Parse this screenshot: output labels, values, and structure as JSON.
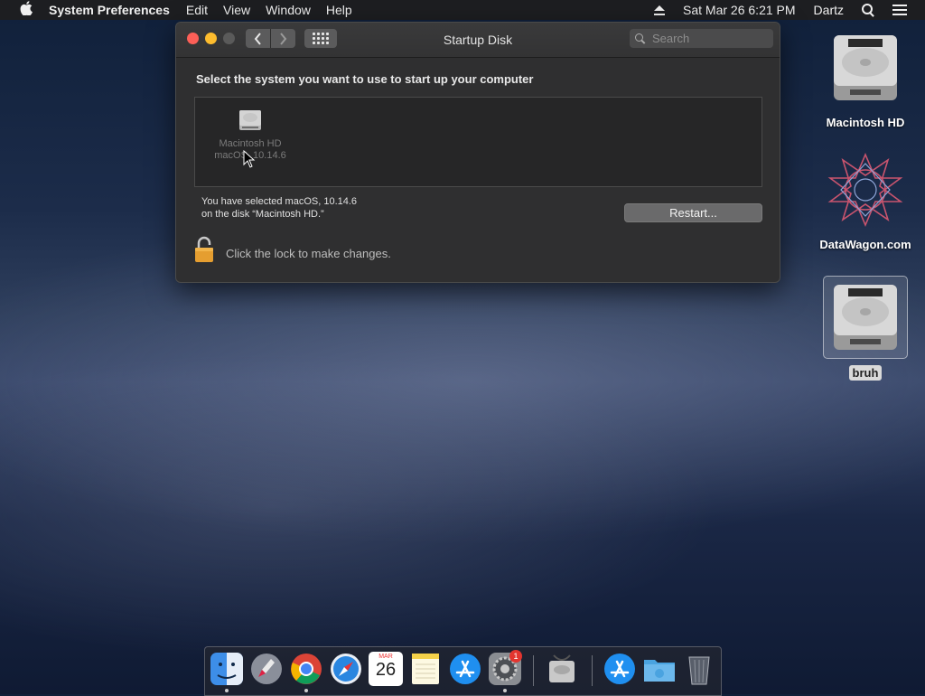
{
  "menubar": {
    "app_name": "System Preferences",
    "menus": [
      "Edit",
      "View",
      "Window",
      "Help"
    ],
    "clock": "Sat Mar 26  6:21 PM",
    "user": "Dartz"
  },
  "window": {
    "title": "Startup Disk",
    "search_placeholder": "Search",
    "heading": "Select the system you want to use to start up your computer",
    "disk_name": "Macintosh HD",
    "disk_os": "macOS, 10.14.6",
    "selected_line1": "You have selected macOS, 10.14.6",
    "selected_line2": "on the disk “Macintosh HD.”",
    "restart_label": "Restart...",
    "lock_label": "Click the lock to make changes."
  },
  "desktop": {
    "icons": [
      {
        "label": "Macintosh HD",
        "icon": "hard-drive-icon"
      },
      {
        "label": "DataWagon.com",
        "icon": "geometric-star-icon"
      },
      {
        "label": "bruh",
        "icon": "hard-drive-icon"
      }
    ]
  },
  "dock": {
    "calendar_month": "MAR",
    "calendar_day": "26",
    "badge_count": "1",
    "apps": [
      "Finder",
      "Launchpad",
      "Chrome",
      "Safari",
      "Calendar",
      "Notes",
      "App Store",
      "System Preferences",
      "Disk Utility",
      "App Store",
      "Folder",
      "Trash"
    ]
  },
  "colors": {
    "close": "#fc5f57",
    "minimize": "#fdbc2e",
    "window_bg": "#2f2f30",
    "lock": "#e59e30"
  }
}
